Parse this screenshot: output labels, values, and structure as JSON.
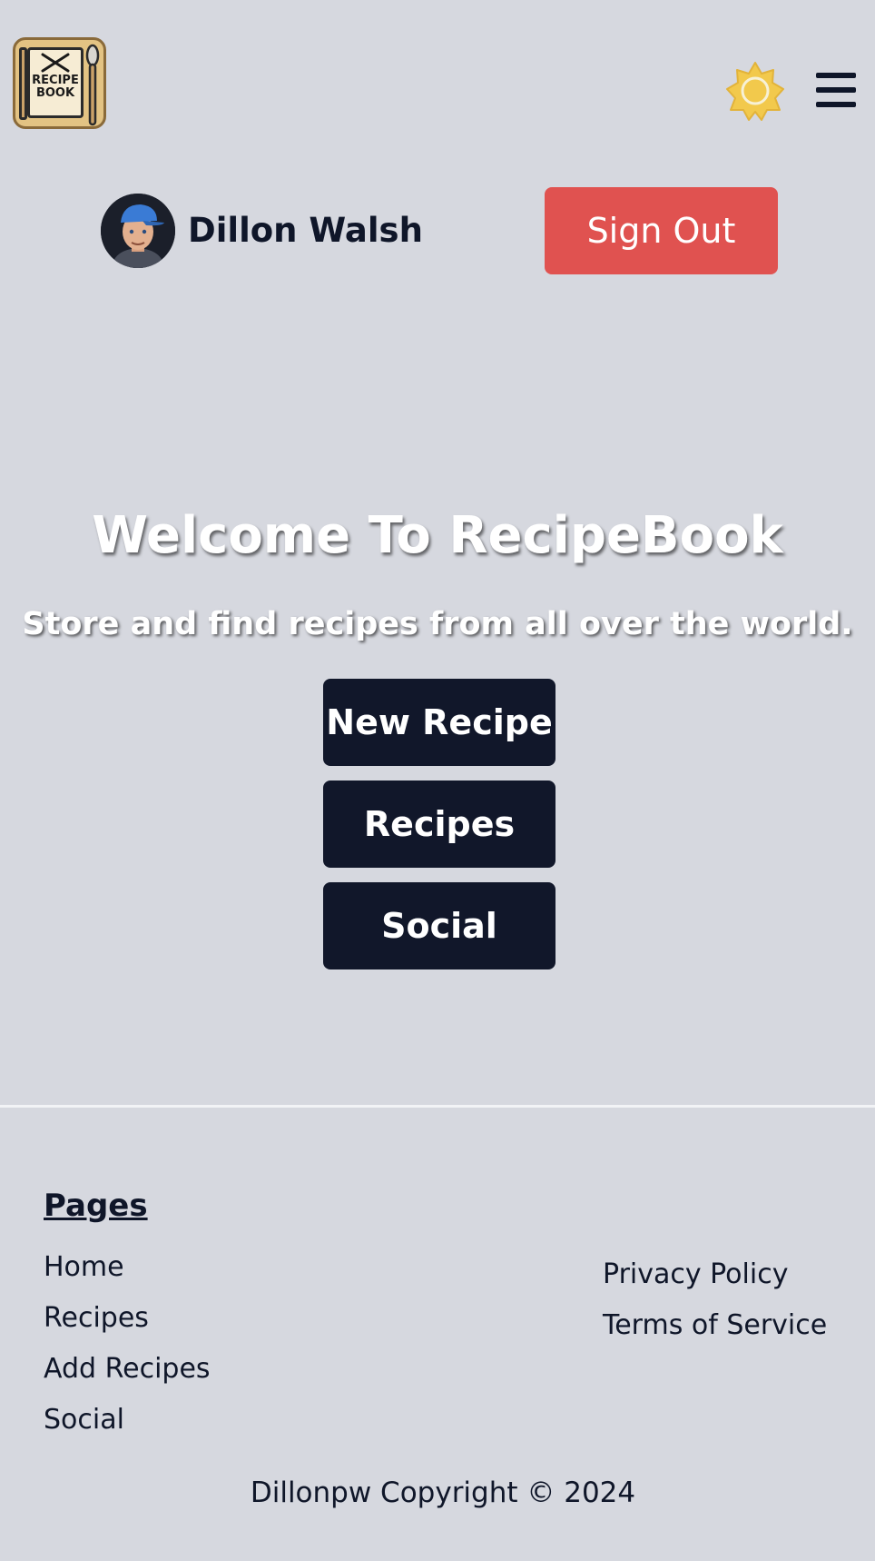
{
  "header": {
    "logo_text_line1": "RECIPE",
    "logo_text_line2": "BOOK",
    "theme_toggle_icon": "sun-icon",
    "menu_icon": "hamburger-menu-icon"
  },
  "user": {
    "name": "Dillon Walsh",
    "avatar_icon": "avatar",
    "sign_out_label": "Sign Out"
  },
  "hero": {
    "title": "Welcome To RecipeBook",
    "subtitle": "Store and find recipes from all over the world.",
    "buttons": [
      "New Recipe",
      "Recipes",
      "Social"
    ]
  },
  "footer": {
    "pages_heading": "Pages",
    "pages_links": [
      "Home",
      "Recipes",
      "Add Recipes",
      "Social"
    ],
    "legal_links": [
      "Privacy Policy",
      "Terms of Service"
    ],
    "copyright": "Dillonpw Copyright © 2024"
  },
  "colors": {
    "background": "#d6d8df",
    "sign_out": "#e05250",
    "primary_button": "#11172a",
    "sun_icon": "#f2c94c",
    "text": "#0f1629"
  }
}
